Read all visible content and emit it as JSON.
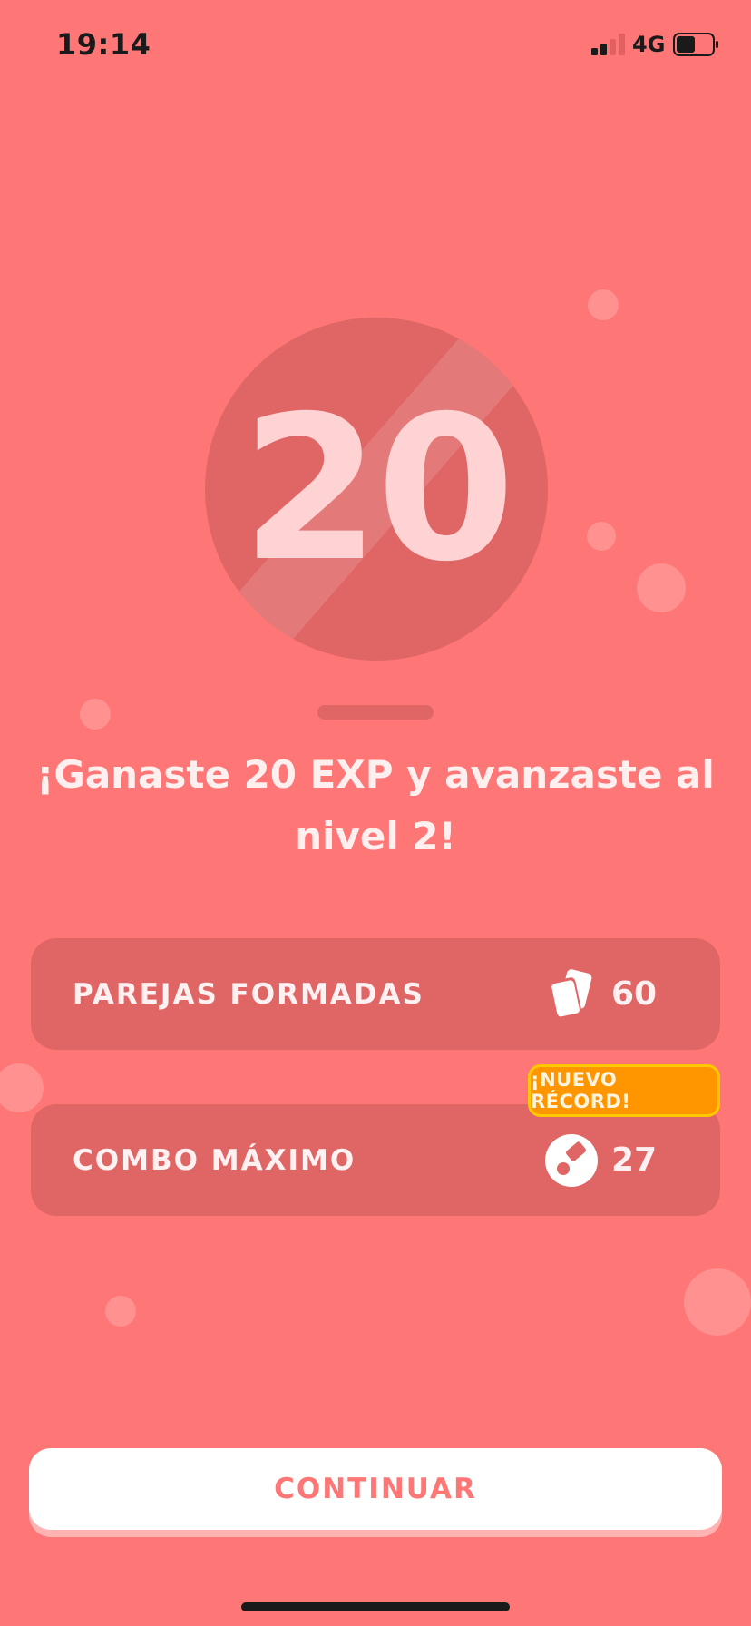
{
  "status": {
    "time": "19:14",
    "network": "4G",
    "signal_icon": "signal-bars-icon",
    "battery_icon": "battery-icon"
  },
  "level": {
    "number": "20"
  },
  "headline": "¡Ganaste 20 EXP y avanzaste al nivel 2!",
  "stats": [
    {
      "label": "PAREJAS FORMADAS",
      "value": "60",
      "icon": "cards-icon"
    },
    {
      "label": "COMBO MÁXIMO",
      "value": "27",
      "icon": "combo-icon"
    }
  ],
  "record_badge": "¡NUEVO RÉCORD!",
  "continue_label": "CONTINUAR",
  "colors": {
    "background": "#FF7676",
    "card": "#E06666",
    "badge": "#FF9600",
    "badge_border": "#FFC800",
    "button_text": "#FF7676"
  }
}
